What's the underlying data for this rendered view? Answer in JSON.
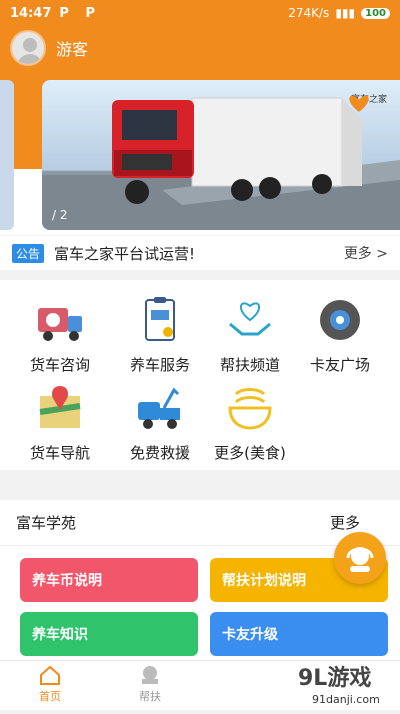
{
  "status": {
    "time": "14:47",
    "pp": "P P",
    "speed": "274K/s",
    "battery": "100"
  },
  "header": {
    "username": "游客"
  },
  "banner": {
    "indicator": "/ 2",
    "logo_text": "富车之家"
  },
  "notice": {
    "tag": "公告",
    "text": "富车之家平台试运营!",
    "more": "更多 >"
  },
  "grid": [
    {
      "label": "货车咨询",
      "icon": "truck-consult-icon"
    },
    {
      "label": "养车服务",
      "icon": "maintenance-clipboard-icon"
    },
    {
      "label": "帮扶频道",
      "icon": "heart-hands-icon"
    },
    {
      "label": "卡友广场",
      "icon": "tire-icon"
    },
    {
      "label": "货车导航",
      "icon": "map-pin-icon"
    },
    {
      "label": "免费救援",
      "icon": "tow-truck-icon"
    },
    {
      "label": "更多(美食)",
      "icon": "noodle-bowl-icon"
    }
  ],
  "academy": {
    "title": "富车学苑",
    "more": "更多",
    "cards": [
      {
        "label": "养车币说明",
        "color": "#f2566b"
      },
      {
        "label": "帮扶计划说明",
        "color": "#f5b400"
      },
      {
        "label": "养车知识",
        "color": "#2fc46c"
      },
      {
        "label": "卡友升级",
        "color": "#3a8ef0"
      }
    ]
  },
  "tabs": [
    {
      "label": "首页",
      "active": true
    },
    {
      "label": "帮扶",
      "active": false
    }
  ],
  "watermark": {
    "brand": "9L游戏",
    "url": "91danji.com"
  }
}
